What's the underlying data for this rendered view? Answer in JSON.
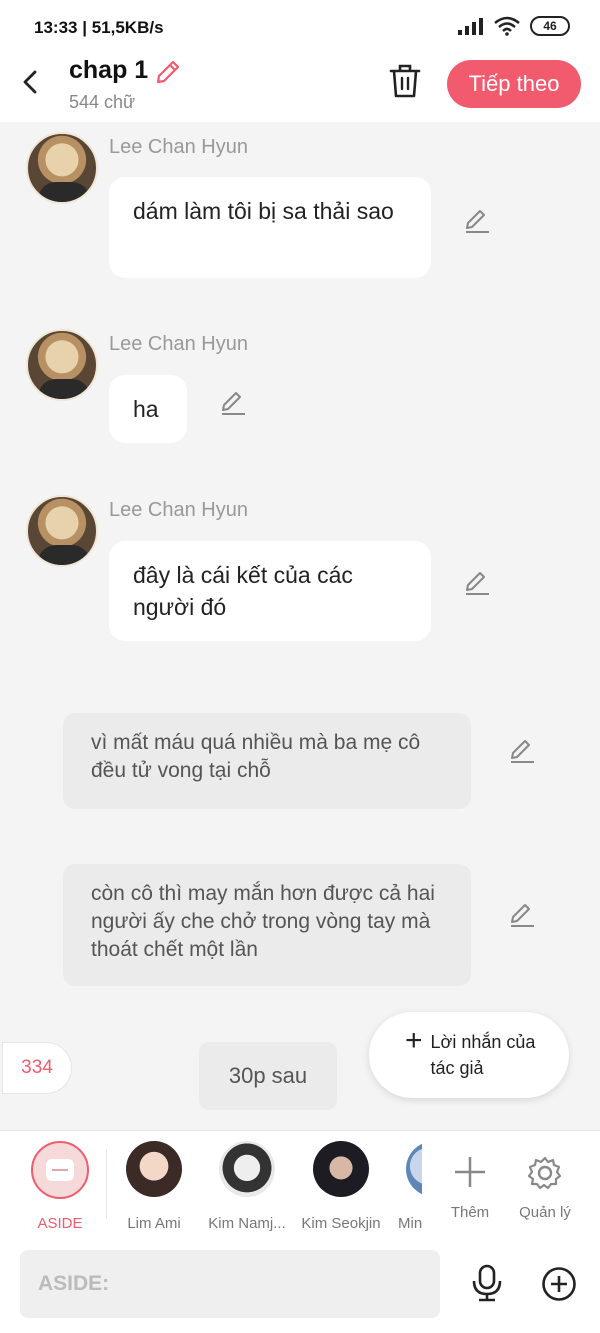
{
  "status_bar": {
    "time": "13:33",
    "network_speed": "51,5KB/s",
    "battery": "46"
  },
  "header": {
    "title": "chap 1",
    "word_count": "544 chữ",
    "next_label": "Tiếp theo"
  },
  "chat": {
    "messages": [
      {
        "speaker": "Lee Chan Hyun",
        "text": "dám làm tôi bị sa thải sao"
      },
      {
        "speaker": "Lee Chan Hyun",
        "text": "ha"
      },
      {
        "speaker": "Lee Chan Hyun",
        "text": "đây là cái kết của các người đó"
      }
    ],
    "narrations": [
      "vì mất máu quá nhiều mà ba mẹ cô đều tử vong tại chỗ",
      "còn cô thì may mắn hơn được cả hai người ấy che chở trong vòng tay mà thoát chết một lần"
    ],
    "time_skip": "30p sau",
    "count": "334",
    "author_note_label": "Lời nhắn của tác giả"
  },
  "characters": [
    {
      "name": "ASIDE",
      "active": true
    },
    {
      "name": "Lim Ami"
    },
    {
      "name": "Kim Namj..."
    },
    {
      "name": "Kim Seokjin"
    },
    {
      "name": "Min"
    }
  ],
  "toolbar": {
    "add_label": "Thêm",
    "manage_label": "Quản lý"
  },
  "input": {
    "placeholder": "ASIDE:"
  },
  "colors": {
    "accent": "#f25a6d",
    "background": "#f4f4f4",
    "narration_bg": "#ebebeb"
  }
}
